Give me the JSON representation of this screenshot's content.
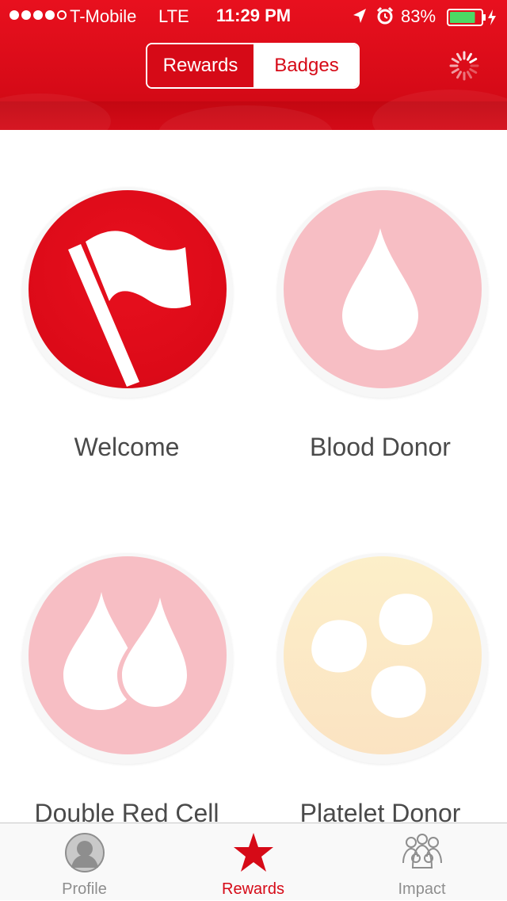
{
  "status_bar": {
    "carrier": "T-Mobile",
    "network": "LTE",
    "time": "11:29 PM",
    "battery": "83%",
    "battery_level": 0.83,
    "signal_bars_filled": 4,
    "signal_bars_total": 5
  },
  "header": {
    "segments": [
      {
        "label": "Rewards",
        "selected": true
      },
      {
        "label": "Badges",
        "selected": false
      }
    ],
    "accent_color": "#d60a17"
  },
  "badges": [
    {
      "label": "Welcome",
      "icon": "flag-icon",
      "color": "#e10b1a"
    },
    {
      "label": "Blood Donor",
      "icon": "blood-drop-icon",
      "color": "#f7bec4"
    },
    {
      "label": "Double Red Cell",
      "icon": "double-drop-icon",
      "color": "#f7bec4"
    },
    {
      "label": "Platelet Donor",
      "icon": "platelet-icon",
      "color": "#fcebc8"
    }
  ],
  "tabbar": {
    "tabs": [
      {
        "label": "Profile",
        "icon": "profile-icon",
        "selected": false
      },
      {
        "label": "Rewards",
        "icon": "star-icon",
        "selected": true
      },
      {
        "label": "Impact",
        "icon": "people-icon",
        "selected": false
      }
    ]
  }
}
